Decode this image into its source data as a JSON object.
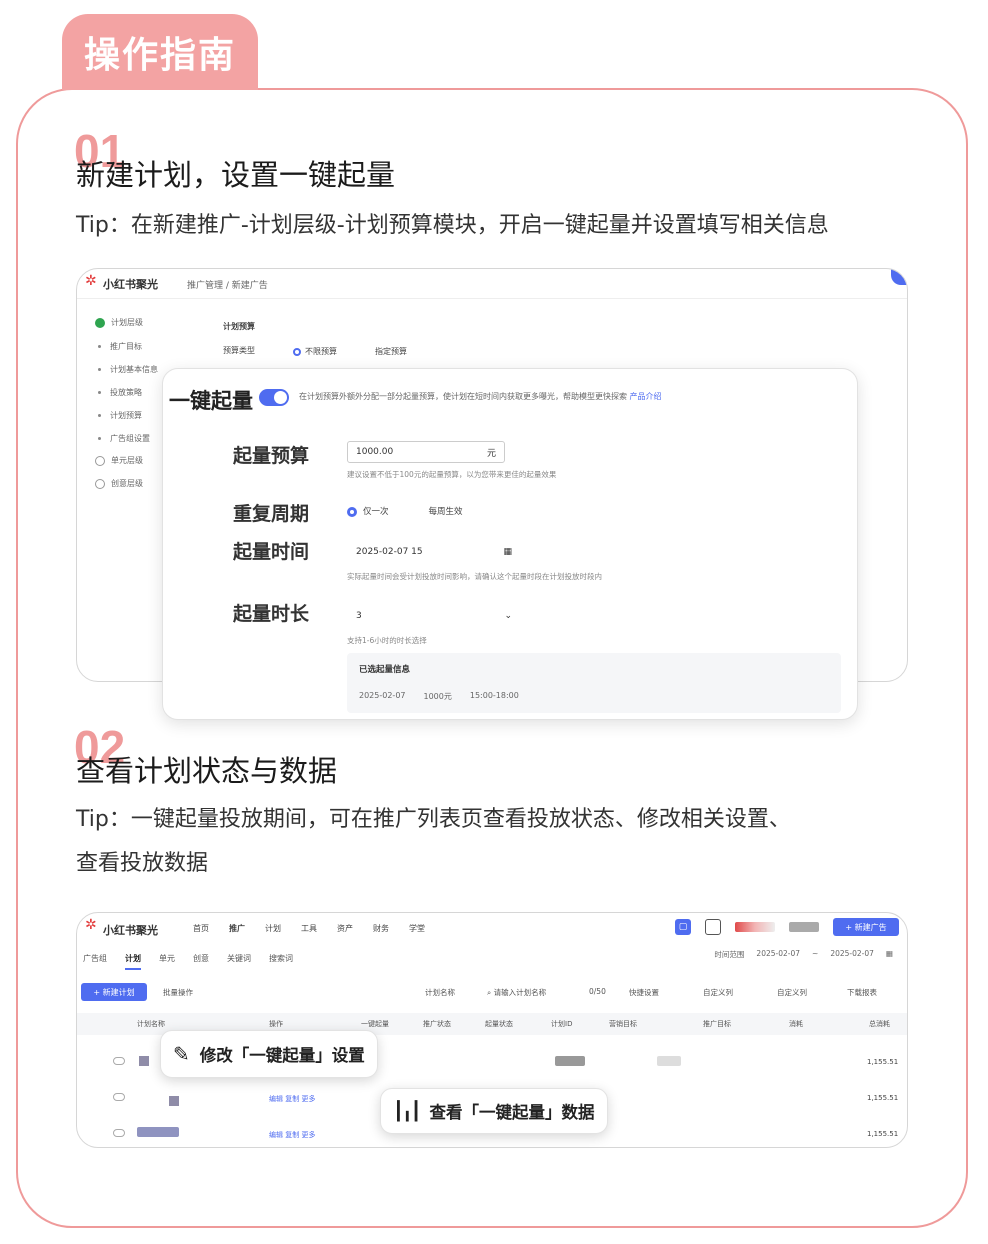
{
  "header": {
    "title": "操作指南"
  },
  "steps": [
    {
      "number": "01",
      "title": "新建计划，设置一键起量",
      "tip": "Tip：在新建推广-计划层级-计划预算模块，开启一键起量并设置填写相关信息"
    },
    {
      "number": "02",
      "title": "查看计划状态与数据",
      "tip_line1": "Tip：一键起量投放期间，可在推广列表页查看投放状态、修改相关设置、",
      "tip_line2": "查看投放数据"
    }
  ],
  "shot1": {
    "app_name": "小红书聚光",
    "breadcrumb": "推广管理 / 新建广告",
    "sidebar": [
      "计划层级",
      "推广目标",
      "计划基本信息",
      "投放策略",
      "计划预算",
      "广告组设置",
      "单元层级",
      "创意层级"
    ],
    "section_label": "计划预算",
    "budget_type_label": "预算类型",
    "budget_type_opt1": "不限预算",
    "budget_type_opt2": "指定预算",
    "popup": {
      "title": "一键起量",
      "toggle_on": true,
      "desc": "在计划预算外额外分配一部分起量预算，使计划在短时间内获取更多曝光，帮助模型更快探索",
      "link": "产品介绍",
      "budget_label": "起量预算",
      "budget_value": "1000.00",
      "budget_unit": "元",
      "budget_hint": "建议设置不低于100元的起量预算，以为您带来更佳的起量效果",
      "repeat_label": "重复周期",
      "repeat_opt1": "仅一次",
      "repeat_opt2": "每周生效",
      "time_label": "起量时间",
      "time_value": "2025-02-07 15",
      "time_hint": "实际起量时间会受计划投放时间影响，请确认这个起量时段在计划投放时段内",
      "duration_label": "起量时长",
      "duration_value": "3",
      "duration_hint": "支持1-6小时的时长选择",
      "summary_title": "已选起量信息",
      "summary_date": "2025-02-07",
      "summary_amount": "1000元",
      "summary_time": "15:00-18:00"
    }
  },
  "shot2": {
    "app_name": "小红书聚光",
    "nav": [
      "首页",
      "推广",
      "计划",
      "工具",
      "资产",
      "财务",
      "学堂"
    ],
    "new_ad_button": "+ 新建广告",
    "tabs": [
      "广告组",
      "计划",
      "单元",
      "创意",
      "关键词",
      "搜索词"
    ],
    "active_tab": "计划",
    "date_label": "时间范围",
    "date_start": "2025-02-07",
    "date_end": "2025-02-07",
    "new_plan_button": "+ 新建计划",
    "batch_label": "批量操作",
    "filters": [
      "计划名称",
      "请输入计划名称",
      "0/50",
      "快捷设置",
      "自定义列",
      "自定义列",
      "下载报表"
    ],
    "columns": [
      "计划名称",
      "操作",
      "一键起量",
      "推广状态",
      "起量状态",
      "计划ID",
      "营销目标",
      "推广目标",
      "消耗",
      "总消耗"
    ],
    "rows": [
      {
        "cost": "1,155.51"
      },
      {
        "actions": "编辑 复制 更多",
        "cost": "1,155.51"
      },
      {
        "actions": "编辑 复制 更多",
        "cost": "1,155.51"
      }
    ],
    "callout1": "修改「一键起量」设置",
    "callout2": "查看「一键起量」数据"
  },
  "colors": {
    "accent": "#ef9a9a",
    "tab": "#f3a3a3",
    "brand_blue": "#4f6cf0"
  }
}
